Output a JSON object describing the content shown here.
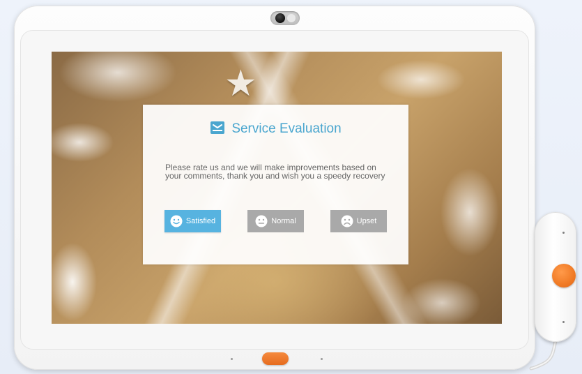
{
  "dialog": {
    "title": "Service Evaluation",
    "message": "Please rate us and we will make improvements based on your comments, thank you and wish you a speedy recovery"
  },
  "ratings": [
    {
      "label": "Satisfied",
      "icon": "smile-face-icon",
      "color": "#57b3e0"
    },
    {
      "label": "Normal",
      "icon": "neutral-face-icon",
      "color": "#a9a9a9"
    },
    {
      "label": "Upset",
      "icon": "sad-face-icon",
      "color": "#a9a9a9"
    }
  ],
  "theme": {
    "accent": "#4aa6cf",
    "call_button": "#f07a25"
  }
}
